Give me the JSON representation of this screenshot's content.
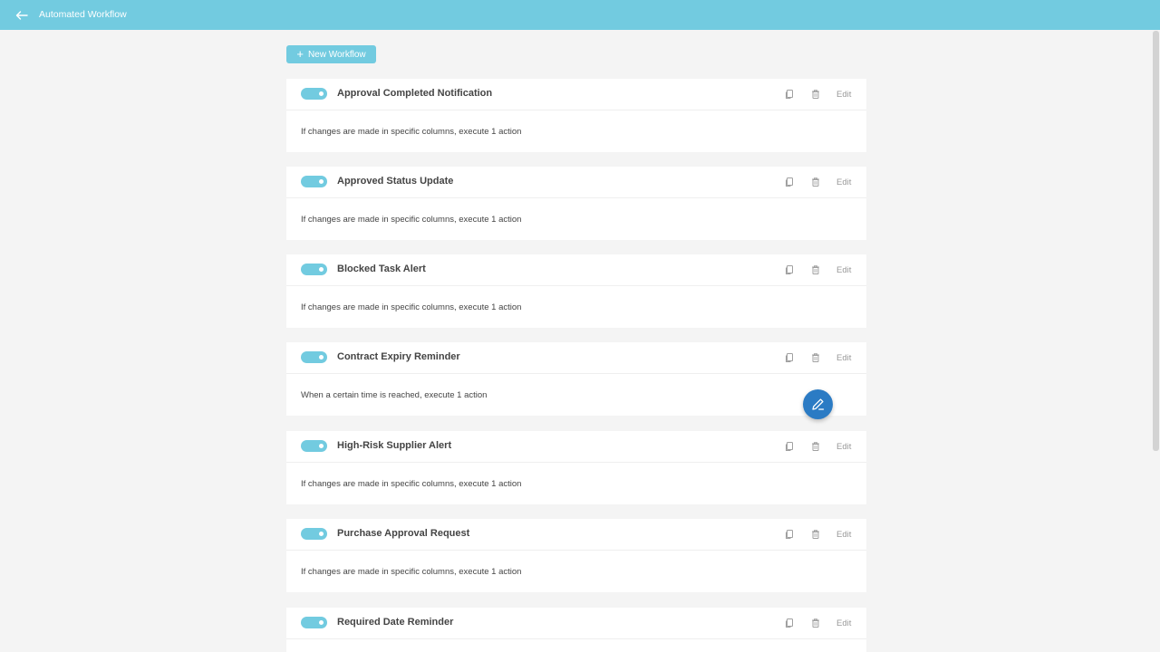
{
  "header": {
    "title": "Automated Workflow"
  },
  "toolbar": {
    "new_workflow_label": "New Workflow"
  },
  "colors": {
    "accent": "#72cbe0",
    "fab": "#2b7bc4",
    "background": "#f4f4f4"
  },
  "workflows": [
    {
      "name": "Approval Completed Notification",
      "description": "If changes are made in specific columns, execute 1 action",
      "enabled": true,
      "edit_label": "Edit"
    },
    {
      "name": "Approved Status Update",
      "description": "If changes are made in specific columns, execute 1 action",
      "enabled": true,
      "edit_label": "Edit"
    },
    {
      "name": "Blocked Task Alert",
      "description": "If changes are made in specific columns, execute 1 action",
      "enabled": true,
      "edit_label": "Edit"
    },
    {
      "name": "Contract Expiry Reminder",
      "description": "When a certain time is reached, execute 1 action",
      "enabled": true,
      "edit_label": "Edit"
    },
    {
      "name": "High-Risk Supplier Alert",
      "description": "If changes are made in specific columns, execute 1 action",
      "enabled": true,
      "edit_label": "Edit"
    },
    {
      "name": "Purchase Approval Request",
      "description": "If changes are made in specific columns, execute 1 action",
      "enabled": true,
      "edit_label": "Edit"
    },
    {
      "name": "Required Date Reminder",
      "description": "",
      "enabled": true,
      "edit_label": "Edit"
    }
  ]
}
